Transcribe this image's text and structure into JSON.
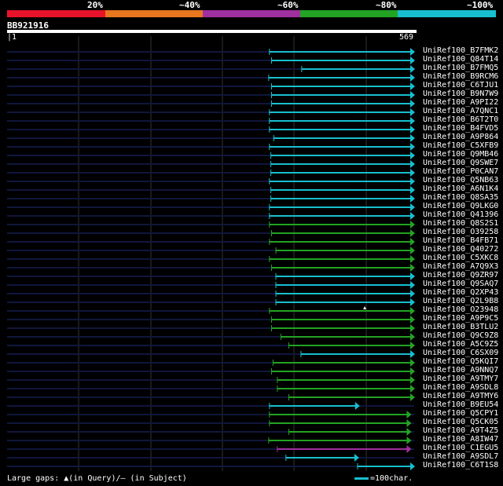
{
  "legend": {
    "labels": [
      "20%",
      "~40%",
      "~60%",
      "~80%",
      "~100%"
    ],
    "colors": [
      "#e8132a",
      "#e8771f",
      "#a02fa0",
      "#23a323",
      "#17bfcf"
    ]
  },
  "query": {
    "name": "BB921916",
    "start": "1",
    "end": "569"
  },
  "colors": {
    "line": "#10163c",
    "grid": "#333333",
    "marker": "#ffffff"
  },
  "chart_data": {
    "type": "alignment_overview",
    "query_length": 569,
    "hits": [
      {
        "name": "UniRef100_B7FMK2",
        "start": 367,
        "end": 569,
        "color": "#17bfcf",
        "arrow": true
      },
      {
        "name": "UniRef100_Q84T14",
        "start": 370,
        "end": 569,
        "color": "#17bfcf",
        "arrow": true
      },
      {
        "name": "UniRef100_B7FMQ5",
        "start": 412,
        "end": 569,
        "color": "#17bfcf",
        "arrow": true
      },
      {
        "name": "UniRef100_B9RCM6",
        "start": 366,
        "end": 569,
        "color": "#17bfcf",
        "arrow": true
      },
      {
        "name": "UniRef100_C6TJU1",
        "start": 370,
        "end": 569,
        "color": "#17bfcf",
        "arrow": true
      },
      {
        "name": "UniRef100_B9N7W9",
        "start": 370,
        "end": 569,
        "color": "#17bfcf",
        "arrow": true
      },
      {
        "name": "UniRef100_A9PI22",
        "start": 370,
        "end": 569,
        "color": "#17bfcf",
        "arrow": true
      },
      {
        "name": "UniRef100_A7QNC1",
        "start": 367,
        "end": 569,
        "color": "#17bfcf",
        "arrow": true
      },
      {
        "name": "UniRef100_B6T2T0",
        "start": 367,
        "end": 569,
        "color": "#17bfcf",
        "arrow": true
      },
      {
        "name": "UniRef100_B4FVD5",
        "start": 367,
        "end": 569,
        "color": "#17bfcf",
        "arrow": true
      },
      {
        "name": "UniRef100_A9P864",
        "start": 373,
        "end": 569,
        "color": "#17bfcf",
        "arrow": true
      },
      {
        "name": "UniRef100_C5XFB9",
        "start": 367,
        "end": 569,
        "color": "#17bfcf",
        "arrow": true
      },
      {
        "name": "UniRef100_Q9MB46",
        "start": 369,
        "end": 569,
        "color": "#17bfcf",
        "arrow": true
      },
      {
        "name": "UniRef100_Q9SWE7",
        "start": 369,
        "end": 569,
        "color": "#17bfcf",
        "arrow": true
      },
      {
        "name": "UniRef100_P0CAN7",
        "start": 369,
        "end": 569,
        "color": "#17bfcf",
        "arrow": true
      },
      {
        "name": "UniRef100_Q5NB63",
        "start": 367,
        "end": 569,
        "color": "#17bfcf",
        "arrow": true
      },
      {
        "name": "UniRef100_A6N1K4",
        "start": 369,
        "end": 569,
        "color": "#17bfcf",
        "arrow": true
      },
      {
        "name": "UniRef100_Q8SA35",
        "start": 369,
        "end": 569,
        "color": "#17bfcf",
        "arrow": true
      },
      {
        "name": "UniRef100_Q9LKG0",
        "start": 367,
        "end": 569,
        "color": "#17bfcf",
        "arrow": true
      },
      {
        "name": "UniRef100_Q41396",
        "start": 367,
        "end": 569,
        "color": "#17bfcf",
        "arrow": true
      },
      {
        "name": "UniRef100_Q8S2S1",
        "start": 367,
        "end": 569,
        "color": "#23a323",
        "arrow": true
      },
      {
        "name": "UniRef100_O39258",
        "start": 370,
        "end": 569,
        "color": "#23a323",
        "arrow": true
      },
      {
        "name": "UniRef100_B4FB71",
        "start": 367,
        "end": 569,
        "color": "#23a323",
        "arrow": true
      },
      {
        "name": "UniRef100_Q40272",
        "start": 376,
        "end": 569,
        "color": "#23a323",
        "arrow": true
      },
      {
        "name": "UniRef100_C5XKC8",
        "start": 367,
        "end": 569,
        "color": "#23a323",
        "arrow": true
      },
      {
        "name": "UniRef100_A7Q9X3",
        "start": 370,
        "end": 569,
        "color": "#23a323",
        "arrow": true
      },
      {
        "name": "UniRef100_Q9ZR97",
        "start": 376,
        "end": 569,
        "color": "#17bfcf",
        "arrow": true
      },
      {
        "name": "UniRef100_Q9SAQ7",
        "start": 376,
        "end": 569,
        "color": "#17bfcf",
        "arrow": true
      },
      {
        "name": "UniRef100_Q2XP43",
        "start": 376,
        "end": 569,
        "color": "#17bfcf",
        "arrow": true
      },
      {
        "name": "UniRef100_Q2L9B8",
        "start": 376,
        "end": 569,
        "color": "#17bfcf",
        "arrow": true
      },
      {
        "name": "UniRef100_O23948",
        "start": 367,
        "end": 569,
        "color": "#23a323",
        "arrow": true,
        "gap_query": true
      },
      {
        "name": "UniRef100_A9P9C5",
        "start": 370,
        "end": 569,
        "color": "#23a323",
        "arrow": true
      },
      {
        "name": "UniRef100_B3TLU2",
        "start": 370,
        "end": 569,
        "color": "#23a323",
        "arrow": true
      },
      {
        "name": "UniRef100_Q9C9Z8",
        "start": 383,
        "end": 569,
        "color": "#23a323",
        "arrow": true
      },
      {
        "name": "UniRef100_A5C9Z5",
        "start": 394,
        "end": 569,
        "color": "#23a323",
        "arrow": true
      },
      {
        "name": "UniRef100_C6SX09",
        "start": 411,
        "end": 569,
        "color": "#17bfcf",
        "arrow": true
      },
      {
        "name": "UniRef100_Q5KQI7",
        "start": 372,
        "end": 569,
        "color": "#23a323",
        "arrow": true
      },
      {
        "name": "UniRef100_A9NNQ7",
        "start": 370,
        "end": 569,
        "color": "#23a323",
        "arrow": true
      },
      {
        "name": "UniRef100_A9TMY7",
        "start": 378,
        "end": 569,
        "color": "#23a323",
        "arrow": true
      },
      {
        "name": "UniRef100_A9SDL8",
        "start": 378,
        "end": 569,
        "color": "#23a323",
        "arrow": true
      },
      {
        "name": "UniRef100_A9TMY6",
        "start": 394,
        "end": 569,
        "color": "#23a323",
        "arrow": true
      },
      {
        "name": "UniRef100_B9EU54",
        "start": 367,
        "end": 492,
        "color": "#17bfcf",
        "arrow": true
      },
      {
        "name": "UniRef100_Q5CPY1",
        "start": 367,
        "end": 564,
        "color": "#23a323",
        "arrow": true
      },
      {
        "name": "UniRef100_Q5CK05",
        "start": 367,
        "end": 564,
        "color": "#23a323",
        "arrow": true
      },
      {
        "name": "UniRef100_A9T4Z5",
        "start": 394,
        "end": 564,
        "color": "#23a323",
        "arrow": true
      },
      {
        "name": "UniRef100_A8IW47",
        "start": 366,
        "end": 564,
        "color": "#23a323",
        "arrow": true
      },
      {
        "name": "UniRef100_C1EGU5",
        "start": 378,
        "end": 564,
        "color": "#a02fa0",
        "arrow": true
      },
      {
        "name": "UniRef100_A9SDL7",
        "start": 390,
        "end": 491,
        "color": "#17bfcf",
        "arrow": true
      },
      {
        "name": "UniRef100_C6T1S8",
        "start": 490,
        "end": 569,
        "color": "#17bfcf",
        "arrow": true
      }
    ]
  },
  "footer": {
    "gaps_text": "Large gaps: ▲(in Query)/– (in Subject)",
    "scale_text": "=100char."
  }
}
